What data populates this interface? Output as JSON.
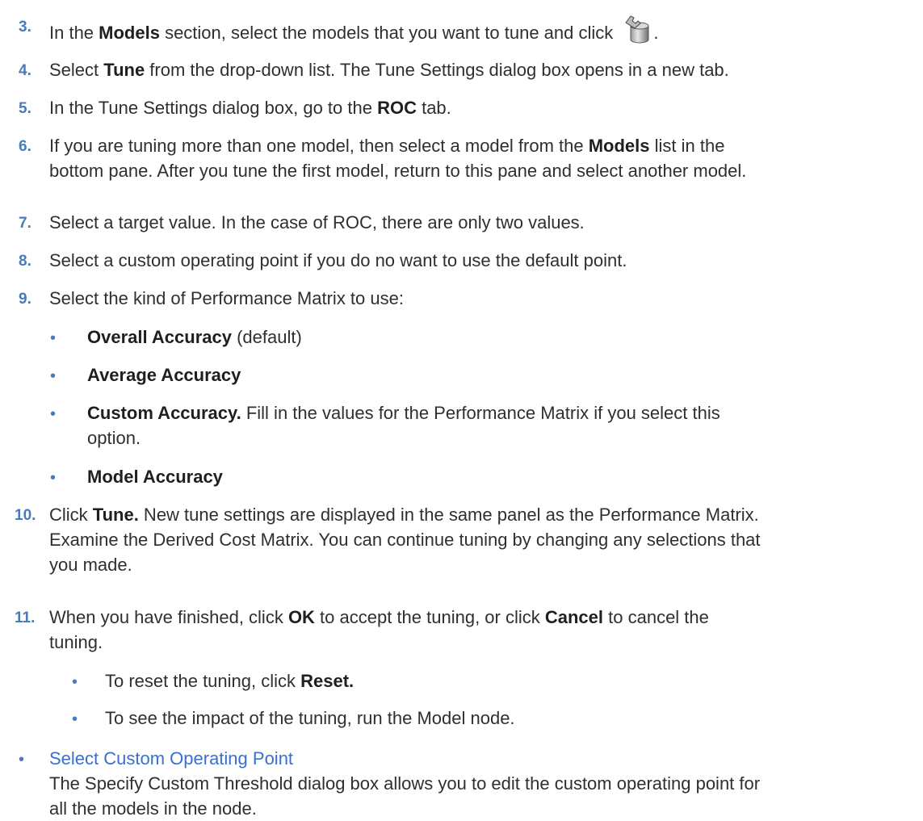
{
  "steps": [
    {
      "num": "3.",
      "parts": [
        "In the ",
        "Models",
        " section, select the models that you want to tune and click ",
        "."
      ]
    },
    {
      "num": "4.",
      "parts": [
        "Select ",
        "Tune",
        " from the drop-down list. The Tune Settings dialog box opens in a new tab."
      ]
    },
    {
      "num": "5.",
      "parts": [
        "In the Tune Settings dialog box, go to the ",
        "ROC",
        " tab."
      ]
    },
    {
      "num": "6.",
      "parts": [
        "If you are tuning more than one model, then select a model from the ",
        "Models",
        " list in the",
        "bottom pane. After you tune the first model, return to this pane and select another model."
      ]
    },
    {
      "num": "7.",
      "parts": [
        "Select a target value. In the case of ROC, there are only two values."
      ]
    },
    {
      "num": "8.",
      "parts": [
        "Select a custom operating point if you do no want to use the default point."
      ]
    },
    {
      "num": "9.",
      "parts": [
        "Select the kind of Performance Matrix to use:"
      ]
    },
    {
      "num": "10.",
      "parts": [
        "Click ",
        "Tune.",
        " New tune settings are displayed in the same panel as the Performance Matrix.",
        "Examine the Derived Cost Matrix. You can continue tuning by changing any selections that",
        "you made."
      ]
    },
    {
      "num": "11.",
      "parts": [
        "When you have finished, click ",
        "OK",
        " to accept the tuning, or click ",
        "Cancel",
        " to cancel the",
        "tuning."
      ]
    }
  ],
  "matrix_options": [
    {
      "bold": "Overall Accuracy",
      "rest": " (default)"
    },
    {
      "bold": "Average Accuracy",
      "rest": ""
    },
    {
      "bold": "Custom Accuracy.",
      "rest": " Fill in the values for the Performance Matrix if you select this",
      "rest2": "option."
    },
    {
      "bold": "Model Accuracy",
      "rest": ""
    }
  ],
  "finish_bullets": [
    {
      "pre": "To reset the tuning, click ",
      "bold": "Reset.",
      "post": ""
    },
    {
      "pre": "To see the impact of the tuning, run the Model node.",
      "bold": "",
      "post": ""
    }
  ],
  "related": {
    "link": "Select Custom Operating Point",
    "line1": "The Specify Custom Threshold dialog box allows you to edit the custom operating point for",
    "line2": "all the models in the node."
  },
  "icons": {
    "tune_icon": "tune-wrench-database-icon"
  },
  "colors": {
    "accent": "#4a7bb8",
    "link": "#3a6fd0",
    "text": "#2f2f2f"
  }
}
